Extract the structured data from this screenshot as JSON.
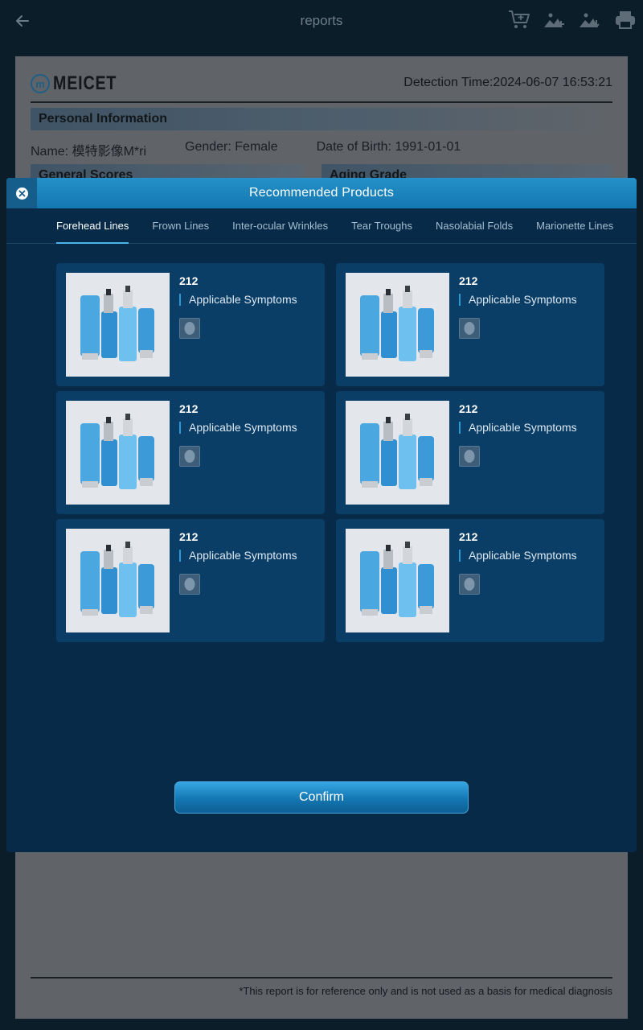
{
  "appbar": {
    "title": "reports",
    "icons": [
      "back-arrow-icon",
      "add-to-cart-icon",
      "add-image-icon",
      "download-image-icon",
      "print-icon"
    ]
  },
  "report": {
    "logo_text": "MEICET",
    "logo_mark": "m",
    "detection_time": "Detection Time:2024-06-07 16:53:21",
    "personal_info_title": "Personal Information",
    "name": "Name: 模特影像M*ri",
    "gender": "Gender: Female",
    "dob": "Date of Birth: 1991-01-01",
    "general_scores_title": "General Scores",
    "aging_grade_title": "Aging Grade",
    "disclaimer": "*This report is for reference only and is not used as a basis for medical diagnosis"
  },
  "modal": {
    "title": "Recommended Products",
    "tabs": [
      {
        "label": "Forehead Lines",
        "active": true
      },
      {
        "label": "Frown Lines",
        "active": false
      },
      {
        "label": "Inter-ocular Wrinkles",
        "active": false
      },
      {
        "label": "Tear Troughs",
        "active": false
      },
      {
        "label": "Nasolabial Folds",
        "active": false
      },
      {
        "label": "Marionette Lines",
        "active": false
      }
    ],
    "products": [
      {
        "name": "212",
        "symptoms_label": "Applicable Symptoms"
      },
      {
        "name": "212",
        "symptoms_label": "Applicable Symptoms"
      },
      {
        "name": "212",
        "symptoms_label": "Applicable Symptoms"
      },
      {
        "name": "212",
        "symptoms_label": "Applicable Symptoms"
      },
      {
        "name": "212",
        "symptoms_label": "Applicable Symptoms"
      },
      {
        "name": "212",
        "symptoms_label": "Applicable Symptoms"
      }
    ],
    "confirm_label": "Confirm"
  },
  "colors": {
    "accent": "#2590c9",
    "modal_bg": "#062a47",
    "card_bg": "#0b3e66",
    "active_tab_underline": "#4fb3ea"
  }
}
